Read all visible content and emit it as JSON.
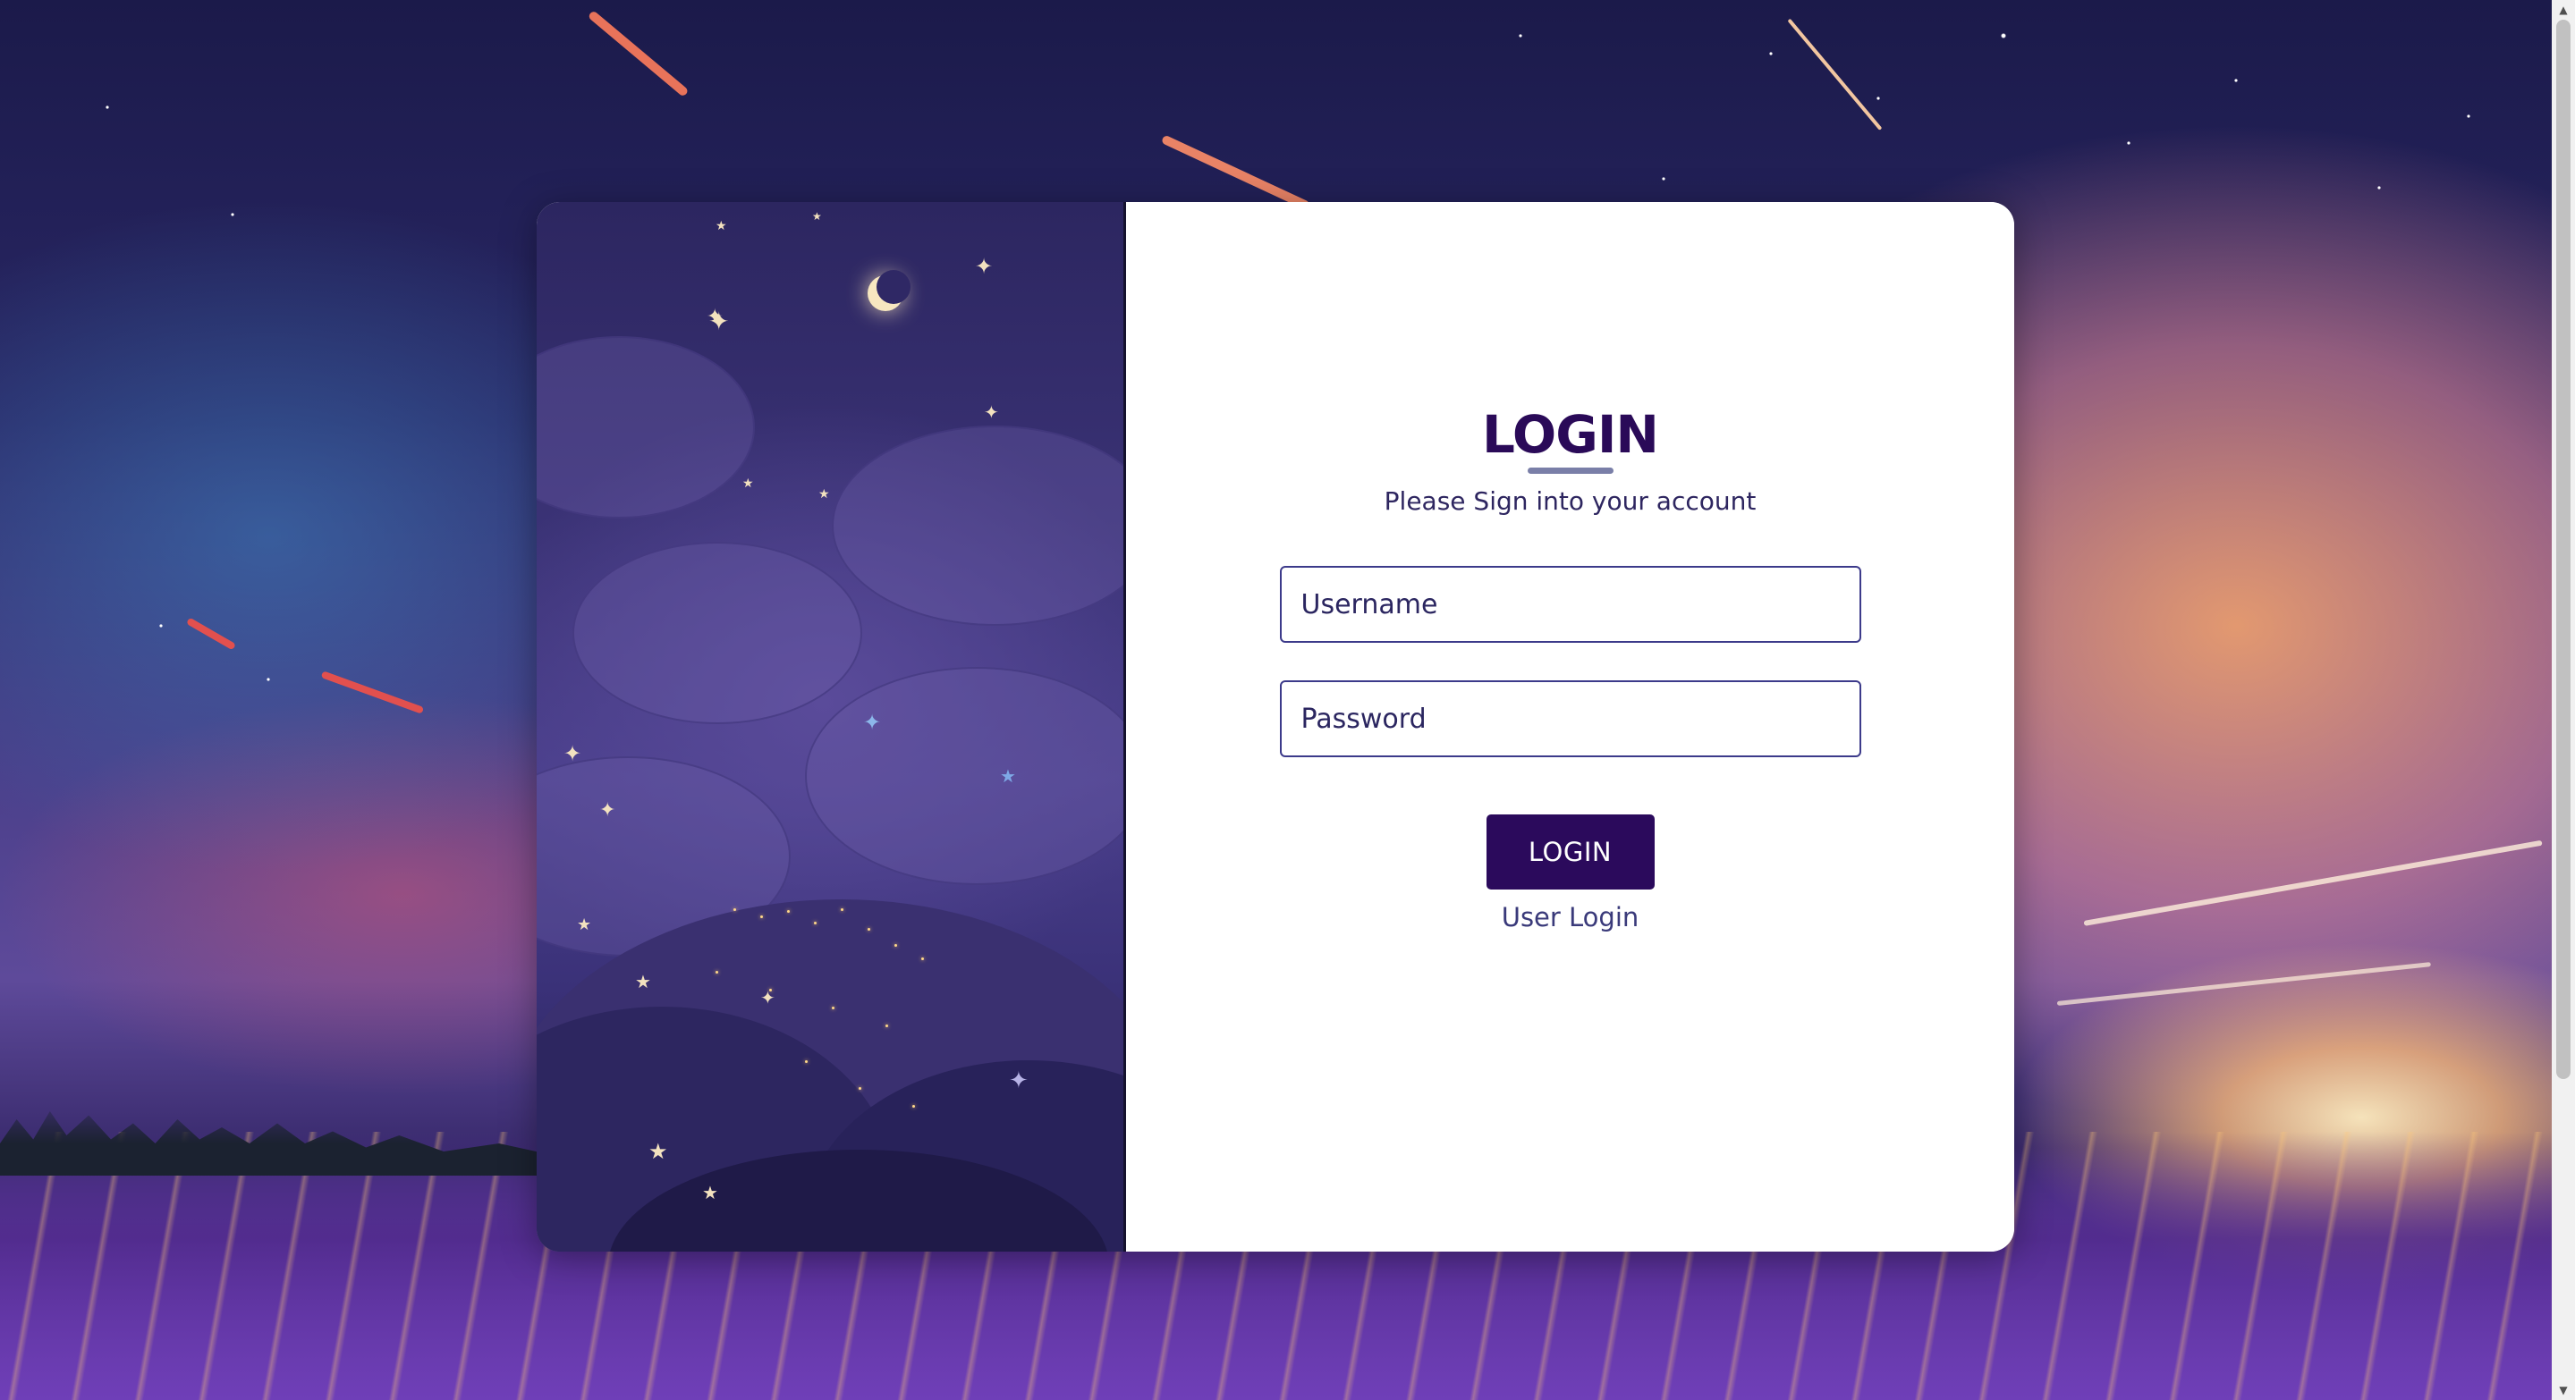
{
  "login": {
    "title": "LOGIN",
    "subtitle": "Please Sign into your account",
    "username_placeholder": "Username",
    "password_placeholder": "Password",
    "button_label": "LOGIN",
    "user_login_link": "User Login"
  },
  "colors": {
    "brand_dark_purple": "#2b0a5c",
    "title_color": "#2a0a58",
    "input_border": "#3c3a8a",
    "underline": "#7a7fa8"
  },
  "icons": {
    "scroll_up": "up-arrow-icon",
    "scroll_down": "down-arrow-icon"
  }
}
